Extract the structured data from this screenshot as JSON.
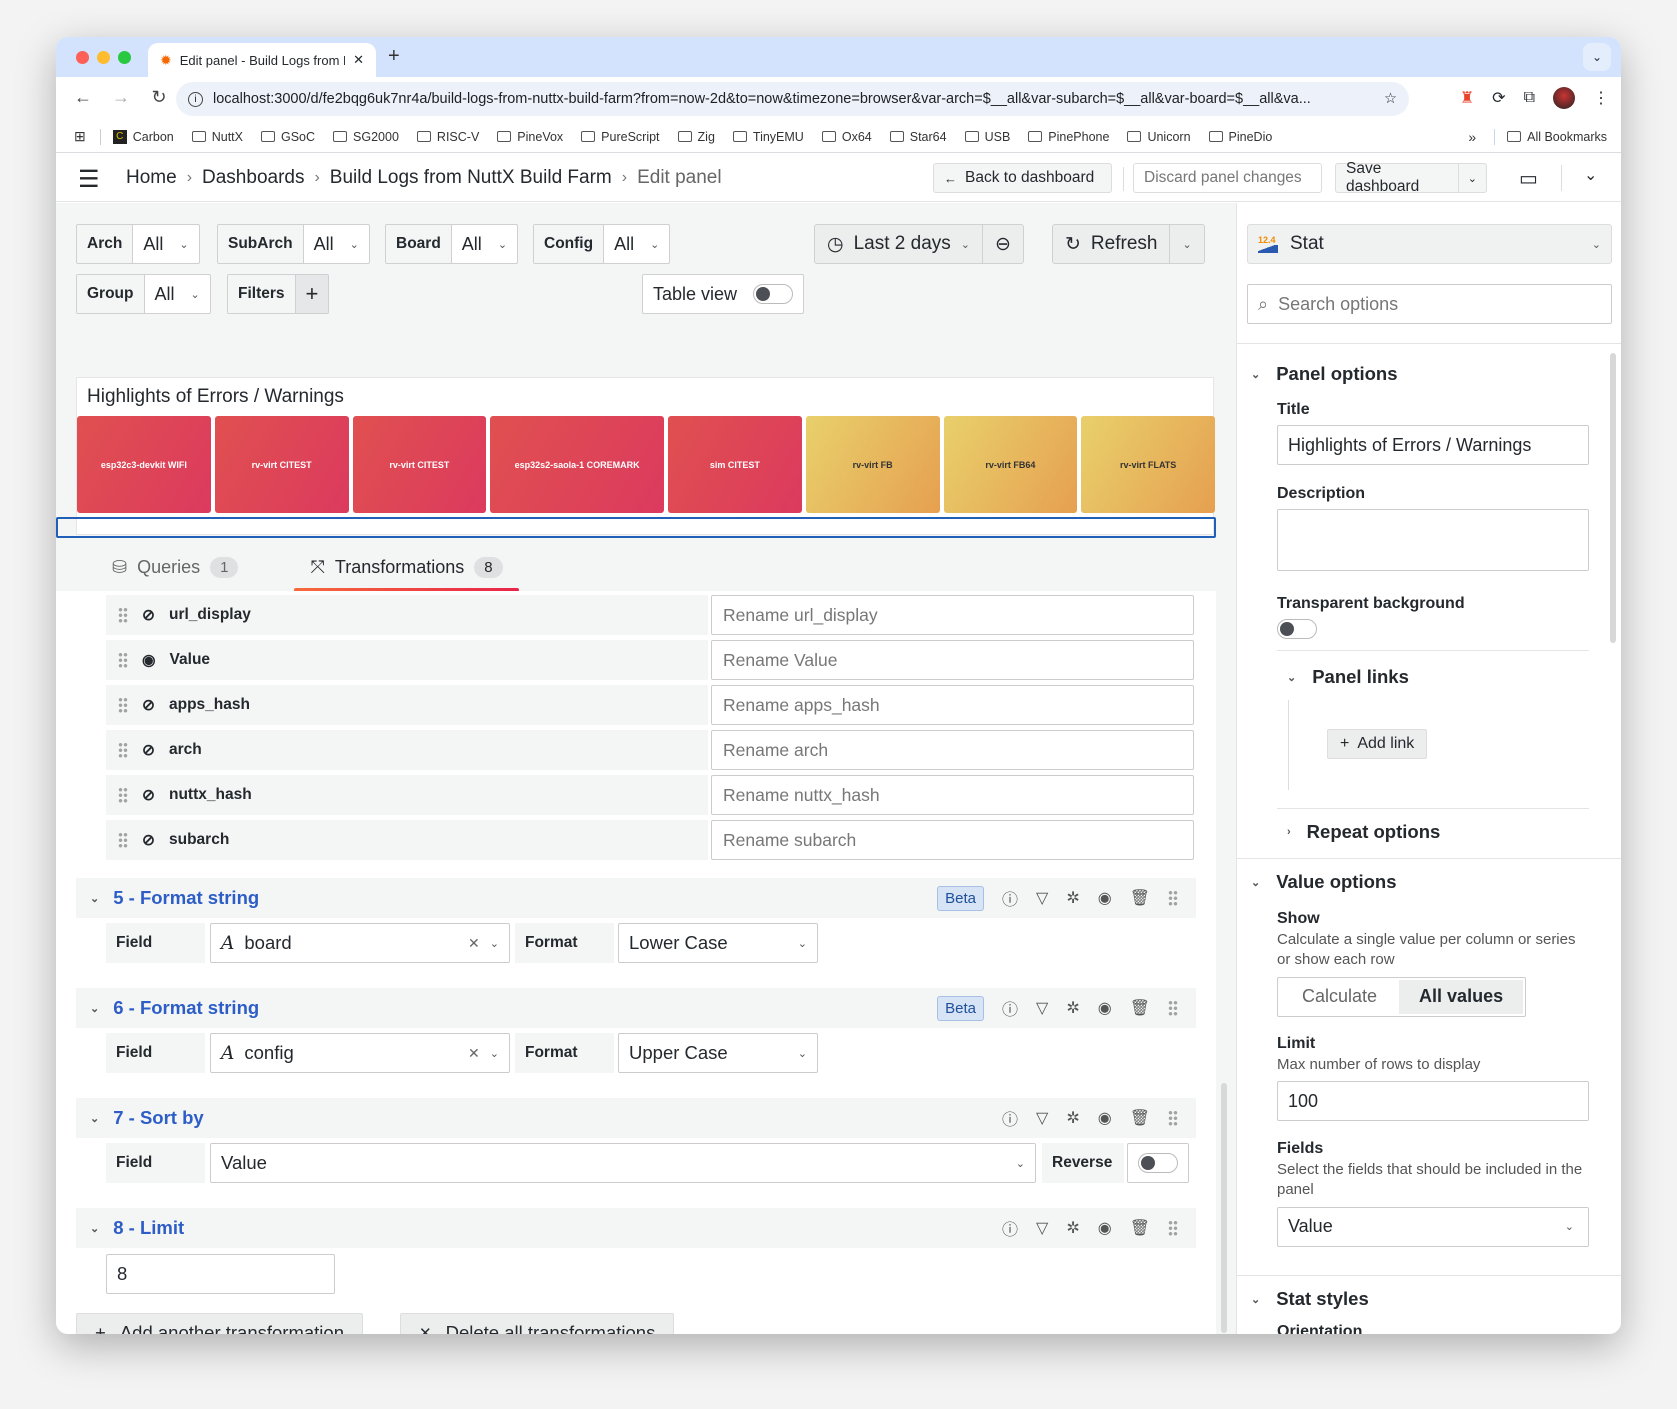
{
  "browser": {
    "tab_title": "Edit panel - Build Logs from NuttX Build Farm",
    "url": "localhost:3000/d/fe2bqg6uk7nr4a/build-logs-from-nuttx-build-farm?from=now-2d&to=now&timezone=browser&var-arch=$__all&var-subarch=$__all&var-board=$__all&va...",
    "bookmarks": [
      "Carbon",
      "NuttX",
      "GSoC",
      "SG2000",
      "RISC-V",
      "PineVox",
      "PureScript",
      "Zig",
      "TinyEMU",
      "Ox64",
      "Star64",
      "USB",
      "PinePhone",
      "Unicorn",
      "PineDio"
    ],
    "all_bookmarks": "All Bookmarks",
    "more": "»"
  },
  "header": {
    "breadcrumbs": [
      "Home",
      "Dashboards",
      "Build Logs from NuttX Build Farm",
      "Edit panel"
    ],
    "back": "Back to dashboard",
    "discard": "Discard panel changes",
    "save": "Save dashboard"
  },
  "variables": [
    {
      "label": "Arch",
      "value": "All"
    },
    {
      "label": "SubArch",
      "value": "All"
    },
    {
      "label": "Board",
      "value": "All"
    },
    {
      "label": "Config",
      "value": "All"
    },
    {
      "label": "Group",
      "value": "All"
    }
  ],
  "filters_label": "Filters",
  "table_view": "Table view",
  "time_range": "Last 2 days",
  "refresh": "Refresh",
  "preview": {
    "title": "Highlights of Errors / Warnings",
    "tiles": [
      {
        "text": "esp32c3-devkit WIFI",
        "color": "red"
      },
      {
        "text": "rv-virt CITEST",
        "color": "red"
      },
      {
        "text": "rv-virt CITEST",
        "color": "red"
      },
      {
        "text": "esp32s2-saola-1 COREMARK",
        "color": "red"
      },
      {
        "text": "sim CITEST",
        "color": "red"
      },
      {
        "text": "rv-virt FB",
        "color": "yellow"
      },
      {
        "text": "rv-virt FB64",
        "color": "yellow"
      },
      {
        "text": "rv-virt FLATS",
        "color": "yellow"
      }
    ]
  },
  "tabs": [
    {
      "label": "Queries",
      "count": "1"
    },
    {
      "label": "Transformations",
      "count": "8"
    }
  ],
  "organize_fields": [
    {
      "name": "url_display",
      "visible": false,
      "placeholder": "Rename url_display"
    },
    {
      "name": "Value",
      "visible": true,
      "placeholder": "Rename Value"
    },
    {
      "name": "apps_hash",
      "visible": false,
      "placeholder": "Rename apps_hash"
    },
    {
      "name": "arch",
      "visible": false,
      "placeholder": "Rename arch"
    },
    {
      "name": "nuttx_hash",
      "visible": false,
      "placeholder": "Rename nuttx_hash"
    },
    {
      "name": "subarch",
      "visible": false,
      "placeholder": "Rename subarch"
    }
  ],
  "transformations": [
    {
      "title": "5 - Format string",
      "beta": "Beta",
      "field_label": "Field",
      "field": "board",
      "format_label": "Format",
      "format": "Lower Case"
    },
    {
      "title": "6 - Format string",
      "beta": "Beta",
      "field_label": "Field",
      "field": "config",
      "format_label": "Format",
      "format": "Upper Case"
    },
    {
      "title": "7 - Sort by",
      "field_label": "Field",
      "field": "Value",
      "reverse_label": "Reverse",
      "reverse": false
    },
    {
      "title": "8 - Limit",
      "limit": "8"
    }
  ],
  "add_transformation": "Add another transformation",
  "delete_all": "Delete all transformations",
  "sidebar": {
    "viz": "Stat",
    "search_placeholder": "Search options",
    "panel_options": "Panel options",
    "title_label": "Title",
    "title_value": "Highlights of Errors / Warnings",
    "description_label": "Description",
    "transparent_label": "Transparent background",
    "panel_links": "Panel links",
    "add_link": "Add link",
    "repeat_options": "Repeat options",
    "value_options": "Value options",
    "show_label": "Show",
    "show_desc": "Calculate a single value per column or series or show each row",
    "show_options": [
      "Calculate",
      "All values"
    ],
    "show_selected": "All values",
    "limit_label": "Limit",
    "limit_desc": "Max number of rows to display",
    "limit_value": "100",
    "fields_label": "Fields",
    "fields_desc": "Select the fields that should be included in the panel",
    "fields_value": "Value",
    "stat_styles": "Stat styles",
    "orientation_label": "Orientation"
  }
}
